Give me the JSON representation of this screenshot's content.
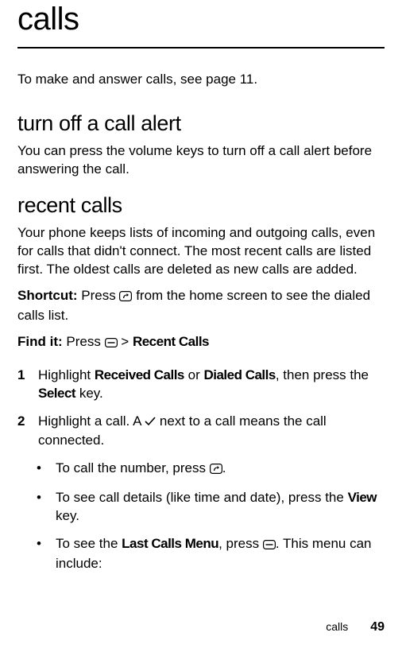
{
  "title": "calls",
  "intro": "To make and answer calls, see page 11.",
  "sections": {
    "turn_off": {
      "heading": "turn off a call alert",
      "body": "You can press the volume keys to turn off a call alert before answering the call."
    },
    "recent": {
      "heading": "recent calls",
      "body": "Your phone keeps lists of incoming and outgoing calls, even for calls that didn't connect. The most recent calls are listed first. The oldest calls are deleted as new calls are added.",
      "shortcut_label": "Shortcut:",
      "shortcut_pre": "Press ",
      "shortcut_post": " from the home screen to see the dialed calls list.",
      "findit_label": "Find it:",
      "findit_pre": "Press ",
      "findit_sep": " > ",
      "findit_item": "Recent Calls",
      "steps": [
        {
          "num": "1",
          "pre": "Highlight ",
          "opt1": "Received Calls",
          "or": " or ",
          "opt2": "Dialed Calls",
          "mid": ", then press the ",
          "key": "Select",
          "post": " key."
        },
        {
          "num": "2",
          "pre": "Highlight a call. A ",
          "post": " next to a call means the call connected."
        }
      ],
      "bullets": [
        {
          "pre": "To call the number, press ",
          "post": "."
        },
        {
          "pre": "To see call details (like time and date), press the ",
          "key": "View",
          "post": " key."
        },
        {
          "pre": "To see the ",
          "key": "Last Calls Menu",
          "mid": ", press ",
          "post": ". This menu can include:"
        }
      ]
    }
  },
  "footer": {
    "label": "calls",
    "page": "49"
  }
}
